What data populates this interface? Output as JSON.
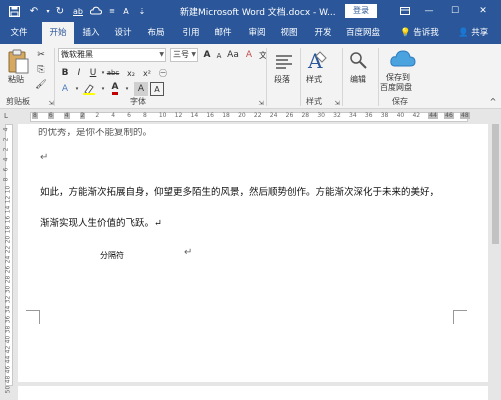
{
  "titlebar": {
    "title": "新建Microsoft Word 文档.docx - W...",
    "login": "登录",
    "restore_icon": "ribbon-display-icon",
    "minimize": "—",
    "maximize": "☐",
    "close": "✕"
  },
  "tabs": [
    "文件",
    "开始",
    "插入",
    "设计",
    "布局",
    "引用",
    "邮件",
    "审阅",
    "视图",
    "开发",
    "百度网盘"
  ],
  "tab_extras": {
    "tell": "告诉我",
    "share": "共享"
  },
  "ribbon": {
    "clipboard": {
      "paste": "粘贴",
      "label": "剪贴板"
    },
    "font": {
      "name": "微软雅黑",
      "size": "三号",
      "grow": "A",
      "shrink": "A",
      "aa": "Aa",
      "bold": "B",
      "italic": "I",
      "underline": "U",
      "strike": "abc",
      "sub": "x₂",
      "sup": "x²",
      "label": "字体"
    },
    "paragraph": {
      "label": "段落"
    },
    "styles": {
      "label": "样式",
      "group_label": "样式"
    },
    "editing": {
      "label": "编辑"
    },
    "save": {
      "line1": "保存到",
      "line2": "百度网盘",
      "group_label": "保存"
    }
  },
  "ruler": {
    "ticks": [
      "8",
      "6",
      "4",
      "2",
      "2",
      "4",
      "6",
      "8",
      "10",
      "12",
      "14",
      "16",
      "18",
      "20",
      "22",
      "24",
      "26",
      "28",
      "30",
      "32",
      "34",
      "36",
      "38",
      "40",
      "42",
      "44",
      "46",
      "48"
    ]
  },
  "vruler": {
    "ticks": [
      "4",
      "2",
      "2",
      "4",
      "6",
      "8",
      "10",
      "12",
      "14",
      "16",
      "18",
      "20",
      "22",
      "24",
      "26",
      "28",
      "30",
      "32",
      "34",
      "36",
      "38",
      "40",
      "42",
      "44",
      "46",
      "48",
      "50"
    ]
  },
  "document": {
    "line0": "的优秀，是你不能复制的。",
    "mark1": "↵",
    "para1": "如此，方能渐次拓展自身，仰望更多陌生的风景，然后顺势创作。方能渐次深化于未来的美好，",
    "para2": "渐渐实现人生价值的飞跃。↵",
    "sign": "分隔符",
    "mark2": "↵"
  }
}
